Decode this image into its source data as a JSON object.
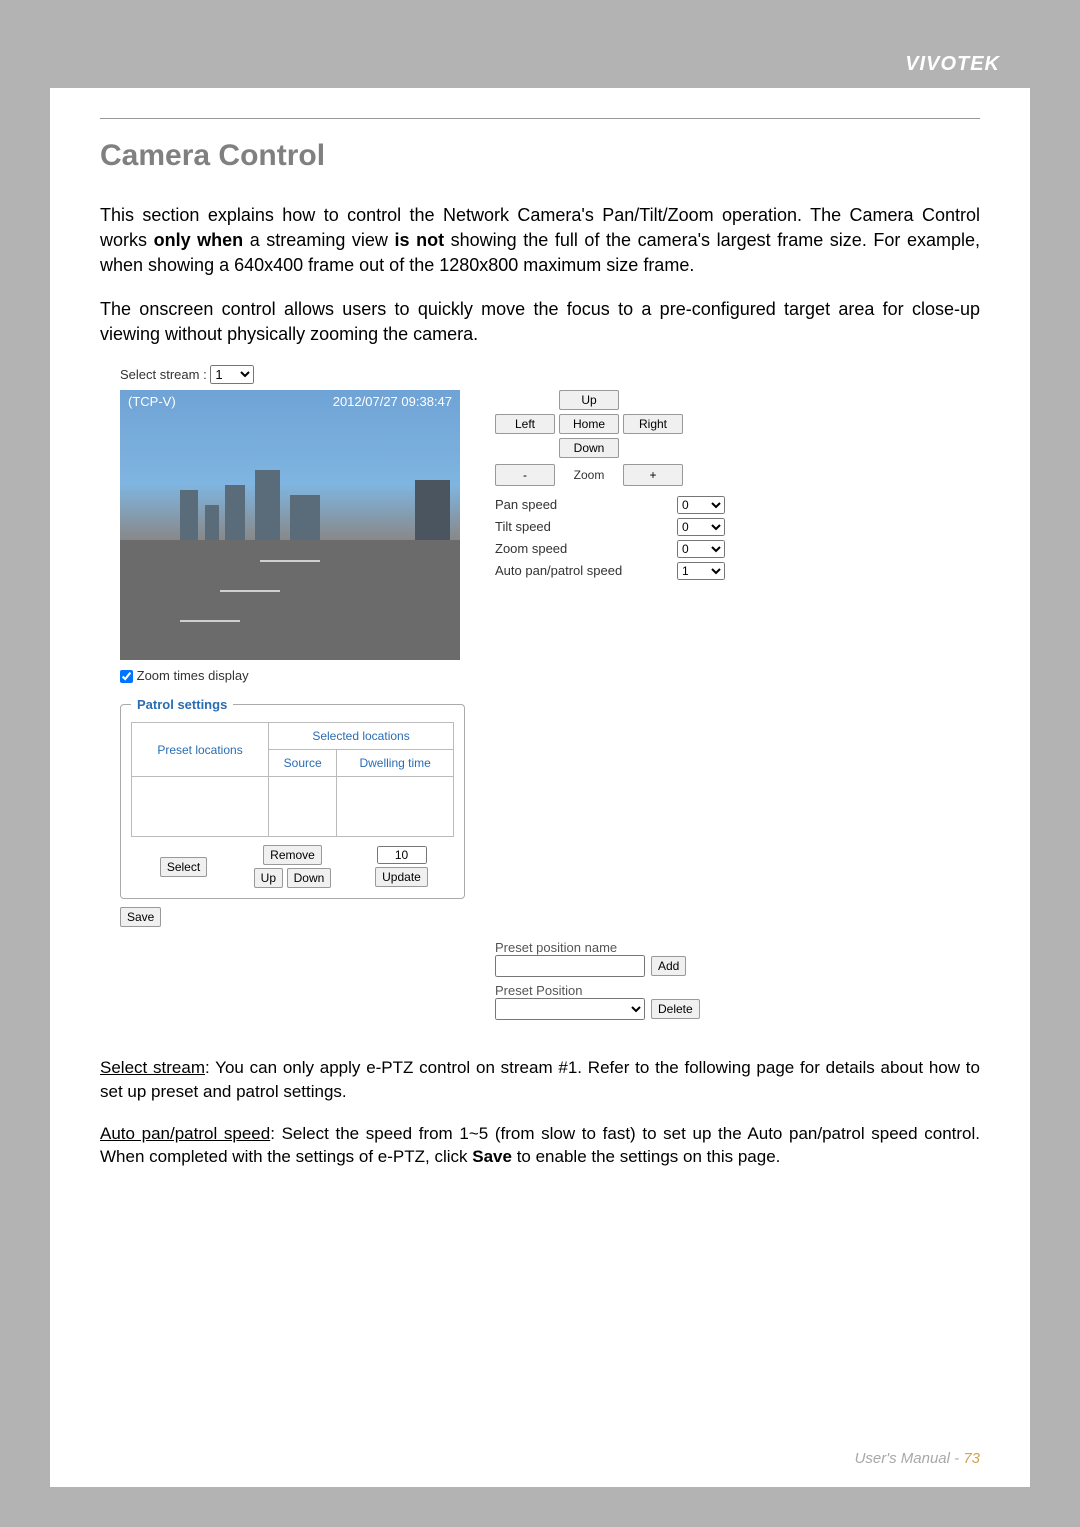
{
  "header": {
    "brand": "VIVOTEK"
  },
  "title": "Camera Control",
  "intro_p1_a": "This section explains how to control the Network Camera's Pan/Tilt/Zoom operation. The Camera Control works ",
  "intro_p1_b": "only when",
  "intro_p1_c": " a streaming view ",
  "intro_p1_d": "is not",
  "intro_p1_e": " showing the full of the camera's largest frame size. For example, when showing a 640x400 frame out of the 1280x800 maximum size frame.",
  "intro_p2": "The onscreen control allows users to quickly move the focus to a pre-configured target area for close-up viewing without physically zooming the camera.",
  "stream": {
    "label": "Select stream :",
    "value": "1"
  },
  "video": {
    "top_left": "(TCP-V)",
    "top_right": "2012/07/27 09:38:47"
  },
  "zoom_times": {
    "label": "Zoom times display",
    "checked": true
  },
  "ptz": {
    "up": "Up",
    "down": "Down",
    "left": "Left",
    "right": "Right",
    "home": "Home",
    "zoom_out": "-",
    "zoom_label": "Zoom",
    "zoom_in": "+",
    "speeds": [
      {
        "label": "Pan speed",
        "value": "0"
      },
      {
        "label": "Tilt speed",
        "value": "0"
      },
      {
        "label": "Zoom speed",
        "value": "0"
      },
      {
        "label": "Auto pan/patrol speed",
        "value": "1"
      }
    ]
  },
  "patrol": {
    "legend": "Patrol settings",
    "col_preset": "Preset locations",
    "col_selected": "Selected locations",
    "col_source": "Source",
    "col_dwelling": "Dwelling time",
    "select_btn": "Select",
    "remove_btn": "Remove",
    "up_btn": "Up",
    "down_btn": "Down",
    "dwelling_value": "10",
    "update_btn": "Update",
    "save_btn": "Save"
  },
  "preset": {
    "name_label": "Preset position name",
    "add_btn": "Add",
    "position_label": "Preset Position",
    "delete_btn": "Delete"
  },
  "lower": {
    "p1_label": "Select stream",
    "p1_text": ": You can only apply e-PTZ control on stream #1. Refer to the following page for details about how to set up preset and patrol settings.",
    "p2_label": "Auto pan/patrol speed",
    "p2_a": ": Select the speed from 1~5 (from slow to fast) to set up the Auto pan/patrol speed control. When completed with the settings of e-PTZ, click ",
    "p2_b": "Save",
    "p2_c": " to enable the settings on this page."
  },
  "footer": {
    "text": "User's Manual - ",
    "page": "73"
  }
}
